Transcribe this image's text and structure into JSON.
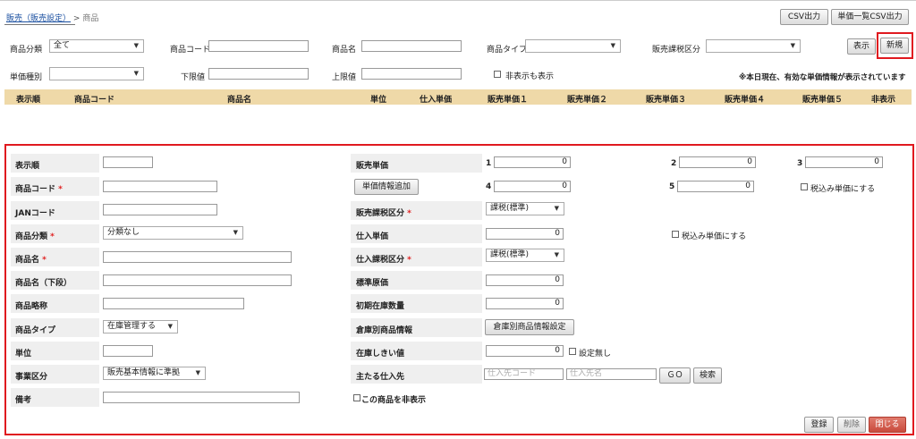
{
  "breadcrumb": {
    "parent": "販売（販売設定）",
    "sep": ">",
    "current": "商品"
  },
  "toolbar": {
    "csv": "CSV出力",
    "price_csv": "単価一覧CSV出力",
    "show": "表示",
    "new": "新規"
  },
  "filters": {
    "category_label": "商品分類",
    "category_value": "全て",
    "code_label": "商品コード",
    "name_label": "商品名",
    "type_label": "商品タイプ",
    "tax_label": "販売課税区分",
    "price_kind_label": "単価種別",
    "lower_label": "下限値",
    "upper_label": "上限値",
    "show_hidden_label": "非表示も表示",
    "notice": "※本日現在、有効な単価情報が表示されています"
  },
  "table_headers": [
    "表示順",
    "商品コード",
    "商品名",
    "単位",
    "仕入単価",
    "販売単価１",
    "販売単価２",
    "販売単価３",
    "販売単価４",
    "販売単価５",
    "非表示"
  ],
  "form": {
    "order": "表示順",
    "code": "商品コード",
    "jan": "JANコード",
    "category": "商品分類",
    "category_value": "分類なし",
    "name": "商品名",
    "name_lower": "商品名（下段）",
    "short": "商品略称",
    "type": "商品タイプ",
    "type_value": "在庫管理する",
    "unit": "単位",
    "business": "事業区分",
    "business_value": "販売基本情報に準拠",
    "note": "備考",
    "required": "*",
    "sale_price": "販売単価",
    "add_price": "単価情報追加",
    "p1": "1",
    "p2": "2",
    "p3": "3",
    "p4": "4",
    "p5": "5",
    "zero": "0",
    "tax_incl": "税込み単価にする",
    "sale_tax": "販売課税区分",
    "tax_value": "課税(標準)",
    "cost": "仕入単価",
    "cost_tax": "仕入課税区分",
    "std_cost": "標準原価",
    "init_stock": "初期在庫数量",
    "warehouse": "倉庫別商品情報",
    "warehouse_btn": "倉庫別商品情報設定",
    "threshold": "在庫しきい値",
    "no_setting": "設定無し",
    "supplier": "主たる仕入先",
    "supplier_code_ph": "仕入先コード",
    "supplier_name_ph": "仕入先名",
    "go": "ＧＯ",
    "search": "検索",
    "hide_item": "この商品を非表示",
    "register": "登録",
    "delete": "削除",
    "close": "閉じる"
  },
  "colors": {
    "header_bg": "#efd9a8",
    "highlight": "#e0191f",
    "close_btn": "#d65a4c"
  }
}
